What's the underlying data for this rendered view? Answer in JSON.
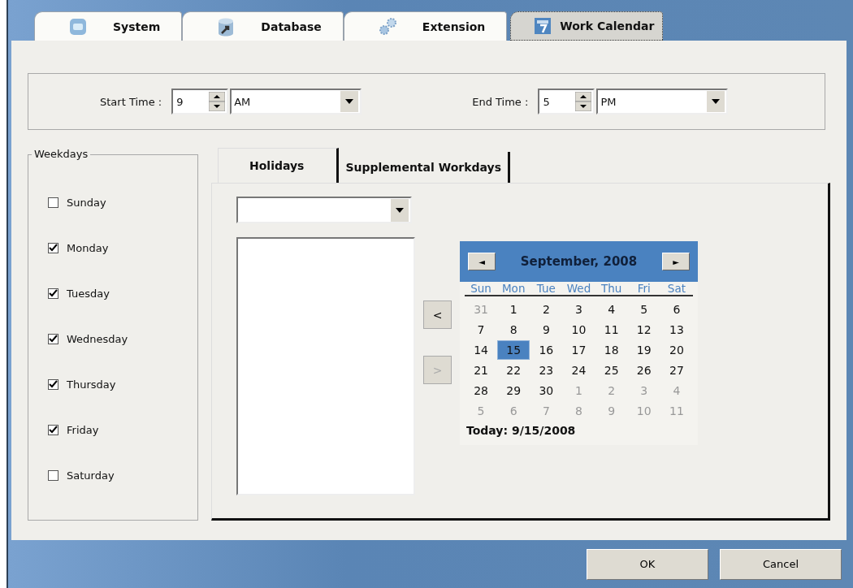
{
  "tabs": [
    {
      "label": "System",
      "kind": "system",
      "selected": false
    },
    {
      "label": "Database",
      "kind": "database",
      "selected": false
    },
    {
      "label": "Extension",
      "kind": "extension",
      "selected": false
    },
    {
      "label": "Work Calendar",
      "kind": "calendar",
      "selected": true
    }
  ],
  "start_time": {
    "label": "Start Time :",
    "hour": "9",
    "period": "AM"
  },
  "end_time": {
    "label": "End Time :",
    "hour": "5",
    "period": "PM"
  },
  "weekdays": {
    "title": "Weekdays",
    "items": [
      {
        "label": "Sunday",
        "checked": false
      },
      {
        "label": "Monday",
        "checked": true
      },
      {
        "label": "Tuesday",
        "checked": true
      },
      {
        "label": "Wednesday",
        "checked": true
      },
      {
        "label": "Thursday",
        "checked": true
      },
      {
        "label": "Friday",
        "checked": true
      },
      {
        "label": "Saturday",
        "checked": false
      }
    ]
  },
  "sub_tabs": [
    {
      "label": "Holidays",
      "selected": true
    },
    {
      "label": "Supplemental Workdays",
      "selected": false
    }
  ],
  "add_button": {
    "label": "<",
    "disabled": false
  },
  "remove_button": {
    "label": ">",
    "disabled": true
  },
  "calendar": {
    "title": "September, 2008",
    "prev": "◄",
    "next": "►",
    "day_names": [
      "Sun",
      "Mon",
      "Tue",
      "Wed",
      "Thu",
      "Fri",
      "Sat"
    ],
    "weeks": [
      [
        {
          "day": "31",
          "muted": true,
          "selected": false
        },
        {
          "day": "1",
          "muted": false,
          "selected": false
        },
        {
          "day": "2",
          "muted": false,
          "selected": false
        },
        {
          "day": "3",
          "muted": false,
          "selected": false
        },
        {
          "day": "4",
          "muted": false,
          "selected": false
        },
        {
          "day": "5",
          "muted": false,
          "selected": false
        },
        {
          "day": "6",
          "muted": false,
          "selected": false
        }
      ],
      [
        {
          "day": "7",
          "muted": false,
          "selected": false
        },
        {
          "day": "8",
          "muted": false,
          "selected": false
        },
        {
          "day": "9",
          "muted": false,
          "selected": false
        },
        {
          "day": "10",
          "muted": false,
          "selected": false
        },
        {
          "day": "11",
          "muted": false,
          "selected": false
        },
        {
          "day": "12",
          "muted": false,
          "selected": false
        },
        {
          "day": "13",
          "muted": false,
          "selected": false
        }
      ],
      [
        {
          "day": "14",
          "muted": false,
          "selected": false
        },
        {
          "day": "15",
          "muted": false,
          "selected": true
        },
        {
          "day": "16",
          "muted": false,
          "selected": false
        },
        {
          "day": "17",
          "muted": false,
          "selected": false
        },
        {
          "day": "18",
          "muted": false,
          "selected": false
        },
        {
          "day": "19",
          "muted": false,
          "selected": false
        },
        {
          "day": "20",
          "muted": false,
          "selected": false
        }
      ],
      [
        {
          "day": "21",
          "muted": false,
          "selected": false
        },
        {
          "day": "22",
          "muted": false,
          "selected": false
        },
        {
          "day": "23",
          "muted": false,
          "selected": false
        },
        {
          "day": "24",
          "muted": false,
          "selected": false
        },
        {
          "day": "25",
          "muted": false,
          "selected": false
        },
        {
          "day": "26",
          "muted": false,
          "selected": false
        },
        {
          "day": "27",
          "muted": false,
          "selected": false
        }
      ],
      [
        {
          "day": "28",
          "muted": false,
          "selected": false
        },
        {
          "day": "29",
          "muted": false,
          "selected": false
        },
        {
          "day": "30",
          "muted": false,
          "selected": false
        },
        {
          "day": "1",
          "muted": true,
          "selected": false
        },
        {
          "day": "2",
          "muted": true,
          "selected": false
        },
        {
          "day": "3",
          "muted": true,
          "selected": false
        },
        {
          "day": "4",
          "muted": true,
          "selected": false
        }
      ],
      [
        {
          "day": "5",
          "muted": true,
          "selected": false
        },
        {
          "day": "6",
          "muted": true,
          "selected": false
        },
        {
          "day": "7",
          "muted": true,
          "selected": false
        },
        {
          "day": "8",
          "muted": true,
          "selected": false
        },
        {
          "day": "9",
          "muted": true,
          "selected": false
        },
        {
          "day": "10",
          "muted": true,
          "selected": false
        },
        {
          "day": "11",
          "muted": true,
          "selected": false
        }
      ]
    ],
    "today": "Today: 9/15/2008"
  },
  "buttons": [
    "OK",
    "Cancel"
  ]
}
